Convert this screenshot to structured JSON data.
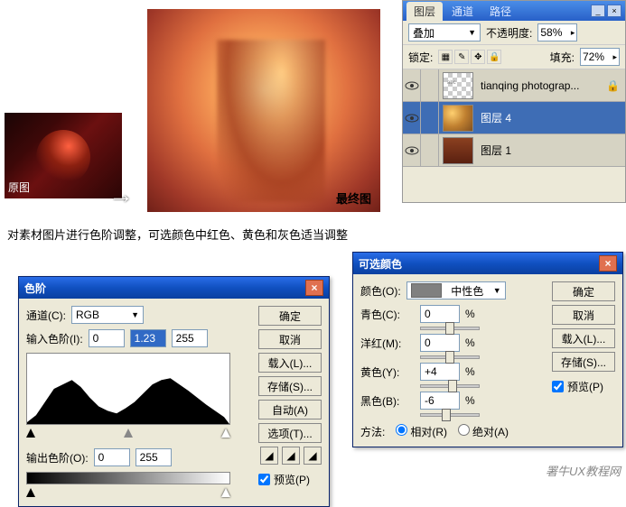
{
  "images": {
    "orig_label": "原图",
    "final_label": "最终图"
  },
  "caption": "对素材图片进行色阶调整，可选颜色中红色、黄色和灰色适当调整",
  "layers_panel": {
    "tabs": [
      "图层",
      "通道",
      "路径"
    ],
    "blend_label": "",
    "blend_mode": "叠加",
    "opacity_label": "不透明度:",
    "opacity_value": "58%",
    "lock_label": "锁定:",
    "fill_label": "填充:",
    "fill_value": "72%",
    "layers": [
      {
        "name": "tianqing photograp...",
        "thumb": "checker",
        "selected": false,
        "locked": true
      },
      {
        "name": "图层 4",
        "thumb": "bokeh",
        "selected": true,
        "locked": false
      },
      {
        "name": "图层 1",
        "thumb": "brown",
        "selected": false,
        "locked": false
      }
    ]
  },
  "levels": {
    "title": "色阶",
    "channel_label": "通道(C):",
    "channel_value": "RGB",
    "input_label": "输入色阶(I):",
    "input_vals": [
      "0",
      "1.23",
      "255"
    ],
    "output_label": "输出色阶(O):",
    "output_vals": [
      "0",
      "255"
    ],
    "buttons": {
      "ok": "确定",
      "cancel": "取消",
      "load": "载入(L)...",
      "save": "存储(S)...",
      "auto": "自动(A)",
      "options": "选项(T)..."
    },
    "preview_label": "预览(P)"
  },
  "selcolor": {
    "title": "可选颜色",
    "color_label": "颜色(O):",
    "color_value": "中性色",
    "sliders": [
      {
        "label": "青色(C):",
        "value": "0",
        "pos": 50
      },
      {
        "label": "洋红(M):",
        "value": "0",
        "pos": 50
      },
      {
        "label": "黄色(Y):",
        "value": "+4",
        "pos": 54
      },
      {
        "label": "黑色(B):",
        "value": "-6",
        "pos": 44
      }
    ],
    "method_label": "方法:",
    "method_relative": "相对(R)",
    "method_absolute": "绝对(A)",
    "buttons": {
      "ok": "确定",
      "cancel": "取消",
      "load": "载入(L)...",
      "save": "存储(S)..."
    },
    "preview_label": "预览(P)"
  },
  "watermark": "署牛UX教程网"
}
